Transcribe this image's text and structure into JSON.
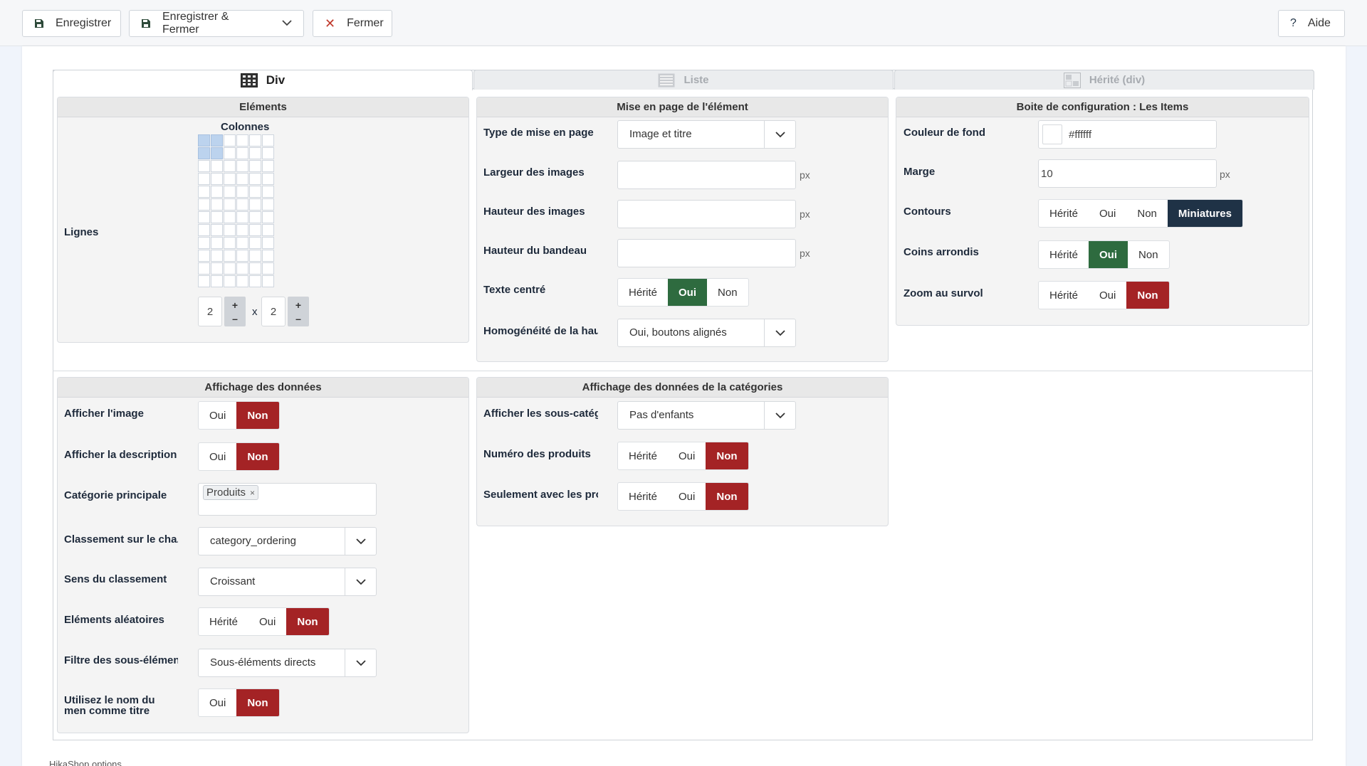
{
  "toolbar": {
    "save_label": "Enregistrer",
    "save_close_label": "Enregistrer & Fermer",
    "close_label": "Fermer",
    "help_label": "Aide",
    "help_glyph": "?"
  },
  "tabs": [
    {
      "label": "Div",
      "icon": "grid-layout-icon"
    },
    {
      "label": "Liste",
      "icon": "list-layout-icon"
    },
    {
      "label": "Hérité (div)",
      "icon": "inherit-layout-icon"
    }
  ],
  "elements": {
    "title": "Eléments",
    "columns_label": "Colonnes",
    "rows_label": "Lignes",
    "columns_value": "2",
    "rows_value": "2",
    "times": "x",
    "plus": "+",
    "minus": "–"
  },
  "layout": {
    "title": "Mise en page de l'élément",
    "type_label": "Type de mise en page",
    "type_value": "Image et titre",
    "img_width_label": "Largeur des images",
    "img_height_label": "Hauteur des images",
    "banner_height_label": "Hauteur du bandeau",
    "px": "px",
    "center_label": "Texte centré",
    "homog_label": "Homogénéité de la hau",
    "homog_value": "Oui, boutons alignés"
  },
  "config": {
    "title": "Boite de configuration : Les Items",
    "bg_label": "Couleur de fond",
    "bg_value": "#ffffff",
    "margin_label": "Marge",
    "margin_value": "10",
    "px": "px",
    "border_label": "Contours",
    "rounded_label": "Coins arrondis",
    "zoom_label": "Zoom au survol"
  },
  "data_display": {
    "title": "Affichage des données",
    "show_image_label": "Afficher l'image",
    "show_desc_label": "Afficher la description",
    "main_cat_label": "Catégorie principale",
    "main_cat_tag": "Produits",
    "tag_remove": "×",
    "order_field_label": "Classement sur le cha..",
    "order_field_value": "category_ordering",
    "order_dir_label": "Sens du classement",
    "order_dir_value": "Croissant",
    "random_label": "Eléments aléatoires",
    "filter_label": "Filtre des sous-élémen",
    "filter_value": "Sous-éléments directs",
    "menu_title_label": "Utilisez le nom du men comme titre"
  },
  "cat_display": {
    "title": "Affichage des données de la catégories",
    "subcat_label": "Afficher les sous-catég",
    "subcat_value": "Pas d'enfants",
    "prod_num_label": "Numéro des produits",
    "only_with_label": "Seulement avec les pro"
  },
  "options": {
    "inherit": "Hérité",
    "yes": "Oui",
    "no": "Non",
    "thumbs": "Miniatures"
  },
  "colors": {
    "green": "#2e6b3f",
    "red": "#a42325",
    "navy": "#1f3246",
    "grid_selected": "#bcd3ee"
  },
  "footer_text": "HikaShop options"
}
